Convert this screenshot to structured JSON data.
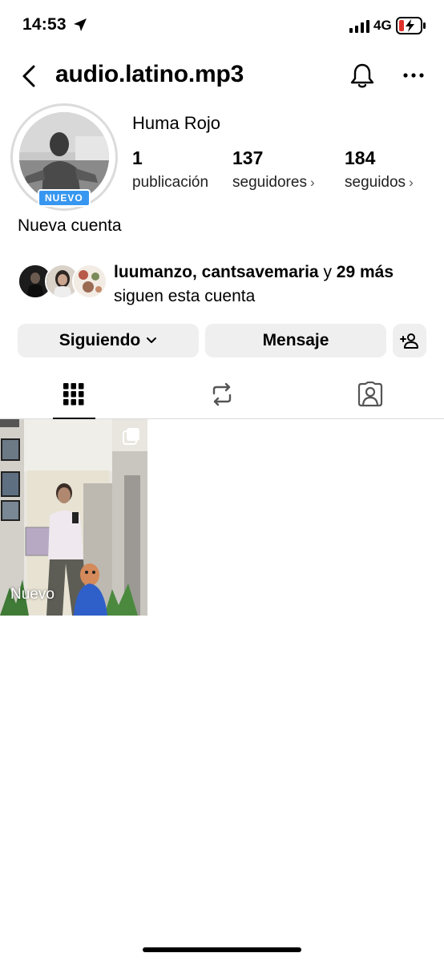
{
  "status_bar": {
    "time": "14:53",
    "network": "4G"
  },
  "header": {
    "username": "audio.latino.mp3"
  },
  "profile": {
    "full_name": "Huma Rojo",
    "badge": "NUEVO",
    "stats": [
      {
        "value": "1",
        "label": "publicación",
        "has_chevron": false
      },
      {
        "value": "137",
        "label": "seguidores",
        "has_chevron": true
      },
      {
        "value": "184",
        "label": "seguidos",
        "has_chevron": true
      }
    ],
    "bio": "Nueva cuenta"
  },
  "followed_by": {
    "names": "luumanzo, cantsavemaria",
    "connector": "y",
    "count": "29",
    "more": "más",
    "suffix": "siguen esta cuenta"
  },
  "actions": {
    "following_label": "Siguiendo",
    "message_label": "Mensaje"
  },
  "tabs": [
    "grid-icon",
    "reposts-icon",
    "tagged-icon"
  ],
  "posts": [
    {
      "label": "Nuevo",
      "type": "carousel"
    }
  ],
  "colors": {
    "badge_blue": "#3797f0",
    "button_gray": "#efefef",
    "divider": "#dbdbdb",
    "battery_low": "#e0302a"
  }
}
